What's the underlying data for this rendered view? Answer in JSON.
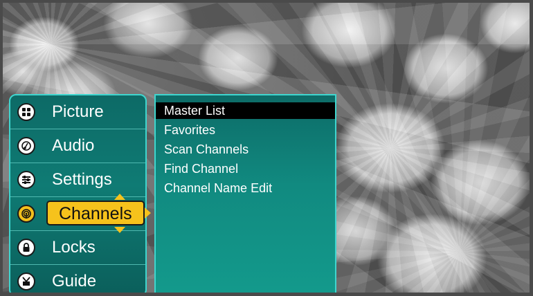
{
  "menu": {
    "items": [
      {
        "label": "Picture",
        "icon": "picture-icon"
      },
      {
        "label": "Audio",
        "icon": "audio-icon"
      },
      {
        "label": "Settings",
        "icon": "settings-icon"
      },
      {
        "label": "Channels",
        "icon": "channels-icon",
        "selected": true
      },
      {
        "label": "Locks",
        "icon": "lock-icon"
      },
      {
        "label": "Guide",
        "icon": "guide-icon"
      }
    ]
  },
  "submenu": {
    "items": [
      {
        "label": "Master List",
        "highlighted": true
      },
      {
        "label": "Favorites"
      },
      {
        "label": "Scan Channels"
      },
      {
        "label": "Find Channel"
      },
      {
        "label": "Channel Name Edit"
      }
    ]
  },
  "colors": {
    "panel": "#0f7b74",
    "border": "#3fd6cf",
    "selection": "#f6c21c",
    "highlight": "#000000"
  }
}
